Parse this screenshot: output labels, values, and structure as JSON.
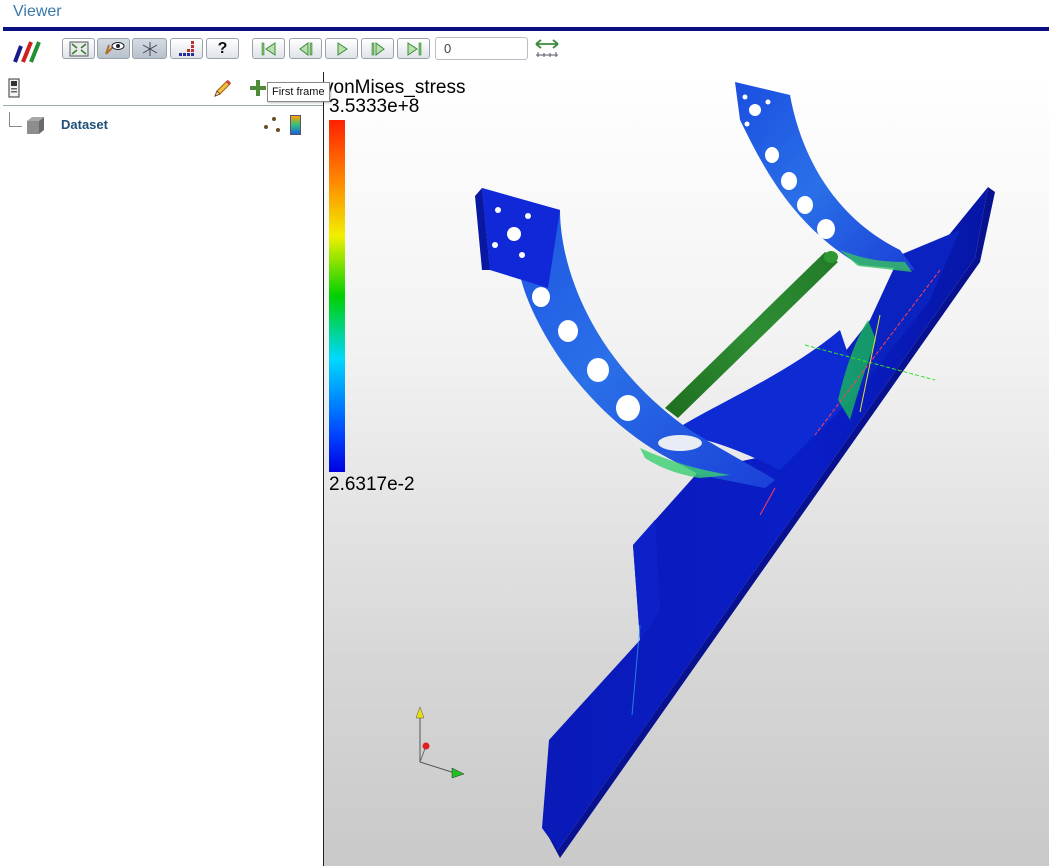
{
  "window": {
    "title": "Viewer"
  },
  "toolbar": {
    "frame_value": "0",
    "buttons": [
      {
        "name": "reset-view",
        "icon": "fit-view-icon"
      },
      {
        "name": "visibility",
        "icon": "eye-icon"
      },
      {
        "name": "axes",
        "icon": "axes-icon"
      },
      {
        "name": "colormap",
        "icon": "colormap-icon"
      },
      {
        "name": "help",
        "icon": "help-icon"
      },
      {
        "name": "first-frame",
        "icon": "first-frame-icon"
      },
      {
        "name": "previous-frame",
        "icon": "previous-frame-icon"
      },
      {
        "name": "play",
        "icon": "play-icon"
      },
      {
        "name": "next-frame",
        "icon": "next-frame-icon"
      },
      {
        "name": "last-frame",
        "icon": "last-frame-icon"
      },
      {
        "name": "scale",
        "icon": "scale-arrows-icon"
      }
    ]
  },
  "tooltip": {
    "text": "First frame"
  },
  "tree": {
    "items": [
      {
        "label": "Dataset"
      }
    ]
  },
  "legend": {
    "title": "vonMises_stress",
    "max": "3.5333e+8",
    "min": "2.6317e-2"
  },
  "colors": {
    "title_text": "#3a78a8",
    "title_rule": "#0a1080",
    "tree_label": "#1f4f7a",
    "model_base": "#0a1cc8"
  }
}
